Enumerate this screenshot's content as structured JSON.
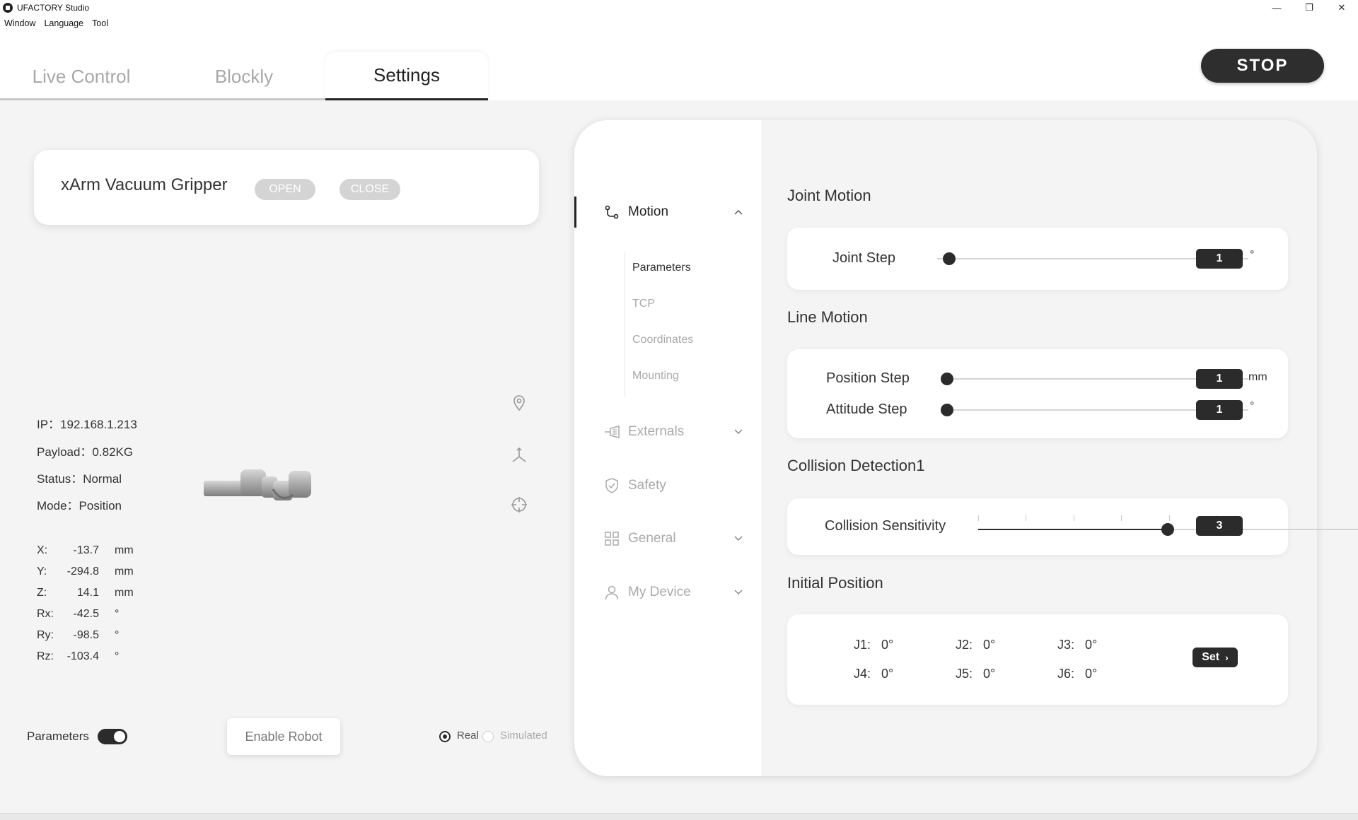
{
  "window": {
    "title": "UFACTORY Studio",
    "minimize": "—",
    "maximize": "❐",
    "close": "✕"
  },
  "menu": [
    "Window",
    "Language",
    "Tool"
  ],
  "tabs": [
    {
      "label": "Live Control",
      "active": false
    },
    {
      "label": "Blockly",
      "active": false
    },
    {
      "label": "Settings",
      "active": true
    }
  ],
  "stop_label": "STOP",
  "gripper": {
    "title": "xArm Vacuum Gripper",
    "open_label": "OPEN",
    "close_label": "CLOSE"
  },
  "robot_info": {
    "ip": "IP：192.168.1.213",
    "payload": "Payload：0.82KG",
    "status": "Status：Normal",
    "mode": "Mode：Position"
  },
  "coordinates": [
    {
      "label": "X:",
      "value": "-13.7",
      "unit": "mm"
    },
    {
      "label": "Y:",
      "value": "-294.8",
      "unit": "mm"
    },
    {
      "label": "Z:",
      "value": "14.1",
      "unit": "mm"
    },
    {
      "label": "Rx:",
      "value": "-42.5",
      "unit": "°"
    },
    {
      "label": "Ry:",
      "value": "-98.5",
      "unit": "°"
    },
    {
      "label": "Rz:",
      "value": "-103.4",
      "unit": "°"
    }
  ],
  "bottom": {
    "parameters_label": "Parameters",
    "parameters_on": true,
    "enable_robot_label": "Enable Robot",
    "mode_real": "Real",
    "mode_simulated": "Simulated",
    "mode_selected": "Real"
  },
  "nav": {
    "motion": "Motion",
    "motion_sub": [
      "Parameters",
      "TCP",
      "Coordinates",
      "Mounting"
    ],
    "motion_sub_active": "Parameters",
    "externals": "Externals",
    "safety": "Safety",
    "general": "General",
    "my_device": "My Device"
  },
  "joint_motion": {
    "title": "Joint Motion",
    "label": "Joint Step",
    "value": "1",
    "unit": "°",
    "fraction": 0.02
  },
  "line_motion": {
    "title": "Line Motion",
    "position": {
      "label": "Position Step",
      "value": "1",
      "unit": "mm",
      "fraction": 0.0
    },
    "attitude": {
      "label": "Attitude Step",
      "value": "1",
      "unit": "°",
      "fraction": 0.0
    }
  },
  "collision": {
    "title": "Collision Detection1",
    "label": "Collision Sensitivity",
    "value": "3",
    "fraction": 0.5
  },
  "initial_position": {
    "title": "Initial Position",
    "joints": [
      {
        "label": "J1:",
        "value": "0°"
      },
      {
        "label": "J2:",
        "value": "0°"
      },
      {
        "label": "J3:",
        "value": "0°"
      },
      {
        "label": "J4:",
        "value": "0°"
      },
      {
        "label": "J5:",
        "value": "0°"
      },
      {
        "label": "J6:",
        "value": "0°"
      }
    ],
    "set_label": "Set"
  },
  "colors": {
    "accent": "#2b2b2b",
    "inactive": "#aaaaaa",
    "panel": "#f4f4f4"
  }
}
